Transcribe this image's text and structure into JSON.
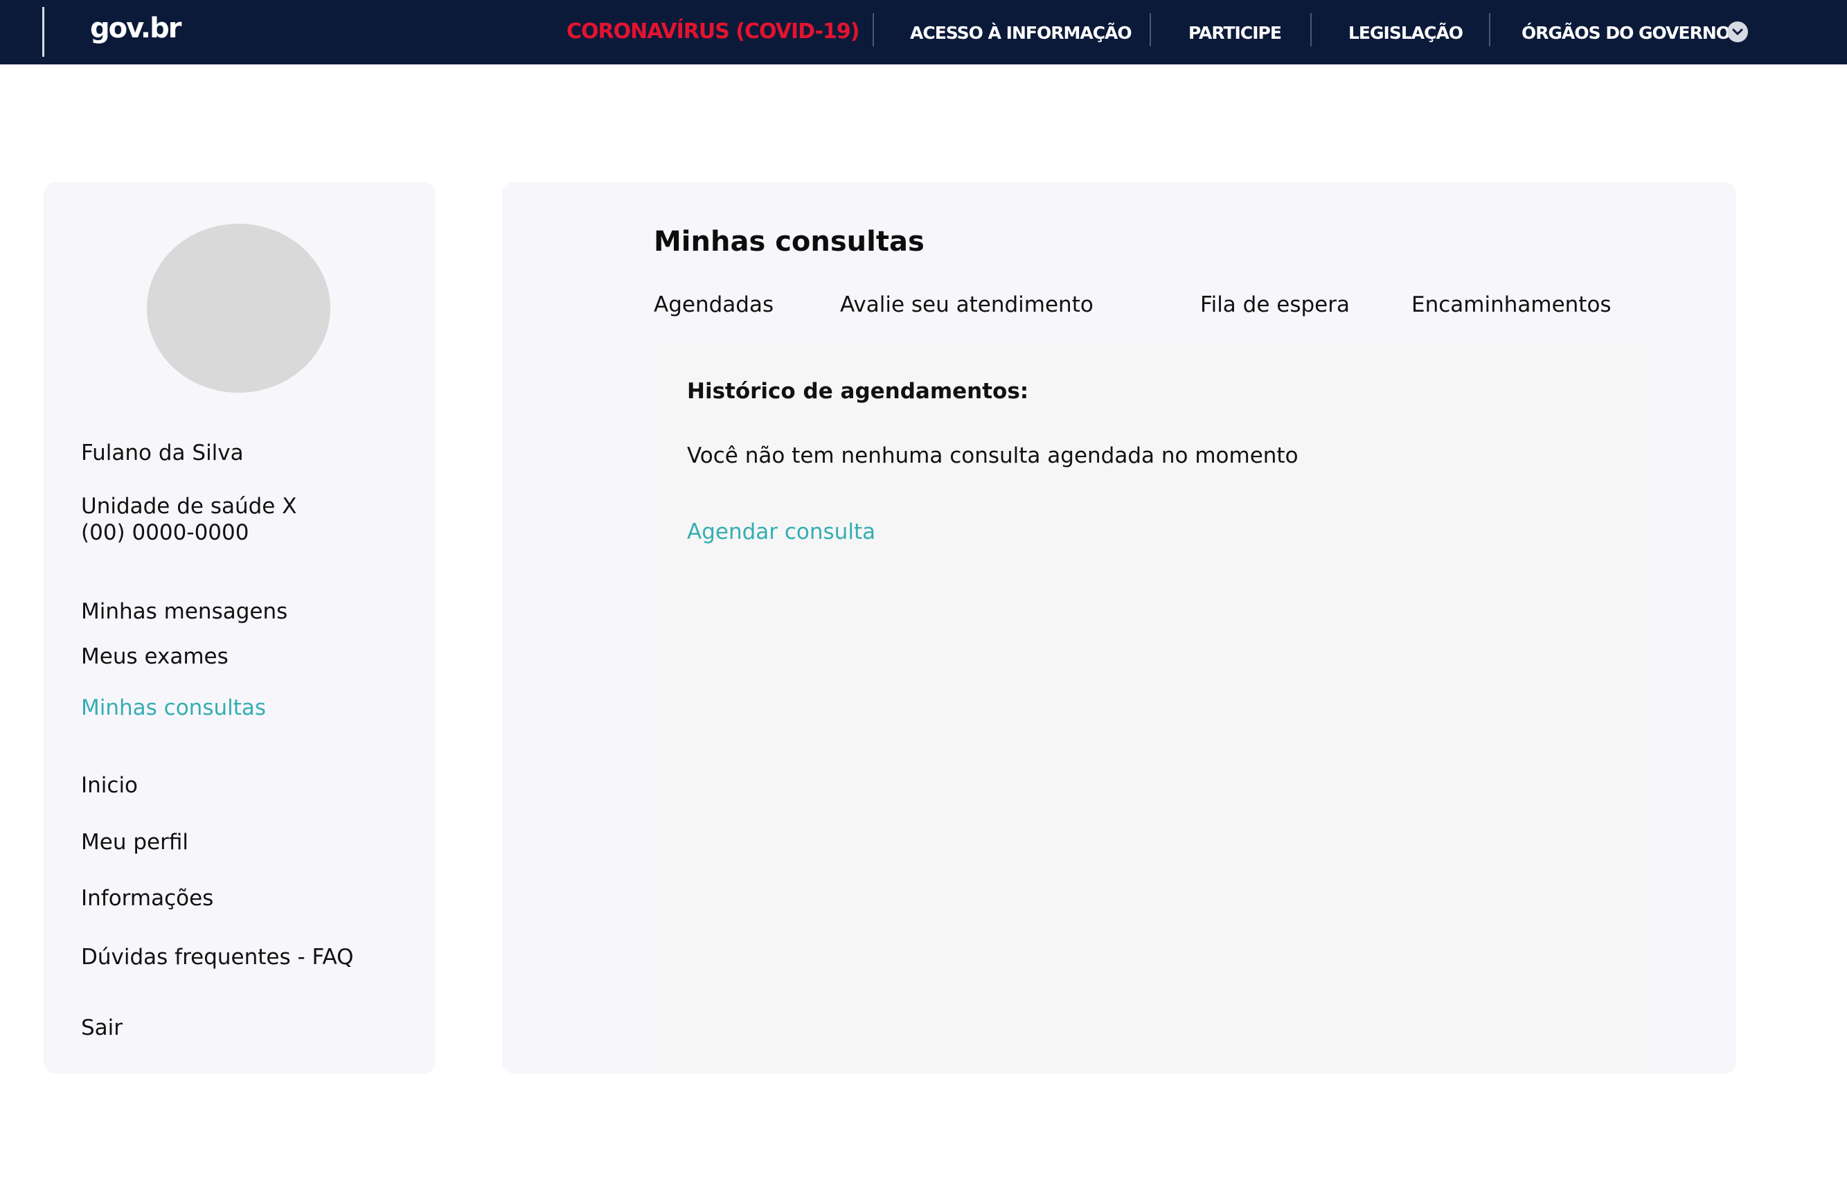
{
  "header": {
    "logo": "gov.br",
    "nav": [
      {
        "label": "CORONAVÍRUS (COVID-19)"
      },
      {
        "label": "ACESSO À INFORMAÇÃO"
      },
      {
        "label": "PARTICIPE"
      },
      {
        "label": "LEGISLAÇÃO"
      },
      {
        "label": "ÓRGÃOS DO GOVERNO"
      }
    ],
    "chevron_icon": "chevron-down-icon"
  },
  "sidebar": {
    "user_name": "Fulano da Silva",
    "unit_name": "Unidade de saúde X",
    "phone": "(00) 0000-0000",
    "menu": [
      {
        "label": "Minhas mensagens"
      },
      {
        "label": "Meus exames"
      },
      {
        "label": "Minhas consultas"
      },
      {
        "label": "Inicio"
      },
      {
        "label": "Meu perfil"
      },
      {
        "label": "Informações"
      },
      {
        "label": "Dúvidas frequentes - FAQ"
      },
      {
        "label": "Sair"
      }
    ],
    "active_item": "Minhas consultas"
  },
  "main": {
    "title": "Minhas consultas",
    "tabs": [
      {
        "label": "Agendadas"
      },
      {
        "label": "Avalie seu atendimento"
      },
      {
        "label": "Fila de espera"
      },
      {
        "label": "Encaminhamentos"
      }
    ],
    "active_tab": "Agendadas",
    "history_title": "Histórico de agendamentos:",
    "empty_message": "Você não tem nenhuma consulta agendada no momento",
    "schedule_link": "Agendar consulta"
  },
  "colors": {
    "topbar": "#0c1a3a",
    "covid": "#e3132f",
    "accent": "#34aeb2",
    "panel": "#f7f7fb",
    "avatar": "#d9d9d9"
  }
}
